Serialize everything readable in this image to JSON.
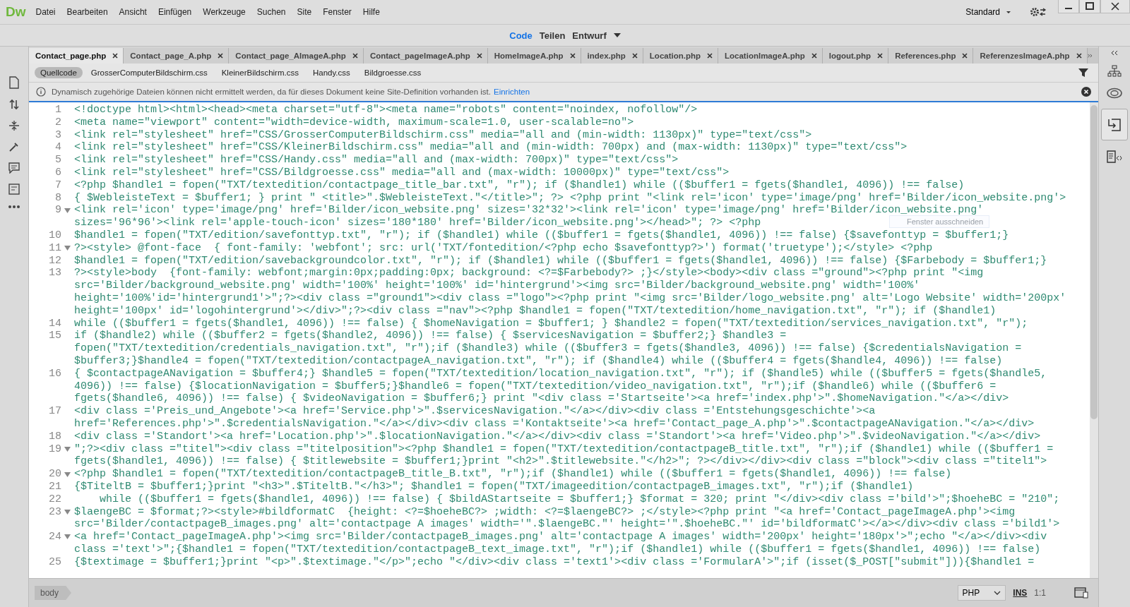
{
  "app_logo": "Dw",
  "menu": [
    "Datei",
    "Bearbeiten",
    "Ansicht",
    "Einfügen",
    "Werkzeuge",
    "Suchen",
    "Site",
    "Fenster",
    "Hilfe"
  ],
  "workspace": "Standard",
  "view_switcher": [
    {
      "label": "Code",
      "selected": true
    },
    {
      "label": "Teilen",
      "selected": false
    },
    {
      "label": "Entwurf",
      "selected": false
    }
  ],
  "tabs": [
    {
      "label": "Contact_page.php",
      "selected": true
    },
    {
      "label": "Contact_page_A.php",
      "selected": false
    },
    {
      "label": "Contact_page_AImageA.php",
      "selected": false
    },
    {
      "label": "Contact_pageImageA.php",
      "selected": false
    },
    {
      "label": "HomeImageA.php",
      "selected": false
    },
    {
      "label": "index.php",
      "selected": false
    },
    {
      "label": "Location.php",
      "selected": false
    },
    {
      "label": "LocationImageA.php",
      "selected": false
    },
    {
      "label": "logout.php",
      "selected": false
    },
    {
      "label": "References.php",
      "selected": false
    },
    {
      "label": "ReferenzesImageA.php",
      "selected": false
    }
  ],
  "related_files": [
    {
      "label": "Quellcode",
      "selected": true
    },
    {
      "label": "GrosserComputerBildschirm.css",
      "selected": false
    },
    {
      "label": "KleinerBildschirm.css",
      "selected": false
    },
    {
      "label": "Handy.css",
      "selected": false
    },
    {
      "label": "Bildgroesse.css",
      "selected": false
    }
  ],
  "info_bar": {
    "message": "Dynamisch zugehörige Dateien können nicht ermittelt werden, da für dieses Dokument keine Site-Definition vorhanden ist.",
    "link": "Einrichten"
  },
  "floating_hint": "Fenster ausschneiden",
  "code_lines": [
    {
      "number": "1",
      "foldable": false,
      "rows": [
        "<!doctype html><html><head><meta charset=\"utf-8\"><meta name=\"robots\" content=\"noindex, nofollow\"/>"
      ]
    },
    {
      "number": "2",
      "foldable": false,
      "rows": [
        "<meta name=\"viewport\" content=\"width=device-width, maximum-scale=1.0, user-scalable=no\">"
      ]
    },
    {
      "number": "3",
      "foldable": false,
      "rows": [
        "<link rel=\"stylesheet\" href=\"CSS/GrosserComputerBildschirm.css\" media=\"all and (min-width: 1130px)\" type=\"text/css\">"
      ]
    },
    {
      "number": "4",
      "foldable": false,
      "rows": [
        "<link rel=\"stylesheet\" href=\"CSS/KleinerBildschirm.css\" media=\"all and (min-width: 700px) and (max-width: 1130px)\" type=\"text/css\">"
      ]
    },
    {
      "number": "5",
      "foldable": false,
      "rows": [
        "<link rel=\"stylesheet\" href=\"CSS/Handy.css\" media=\"all and (max-width: 700px)\" type=\"text/css\">"
      ]
    },
    {
      "number": "6",
      "foldable": false,
      "rows": [
        "<link rel=\"stylesheet\" href=\"CSS/Bildgroesse.css\" media=\"all and (max-width: 10000px)\" type=\"text/css\">"
      ]
    },
    {
      "number": "7",
      "foldable": false,
      "rows": [
        "<?php $handle1 = fopen(\"TXT/textedition/contactpage_title_bar.txt\", \"r\"); if ($handle1) while (($buffer1 = fgets($handle1, 4096)) !== false)"
      ]
    },
    {
      "number": "8",
      "foldable": false,
      "rows": [
        "{ $WebleisteText = $buffer1; } print \" <title>\".$WebleisteText.\"</title>\"; ?> <?php print \"<link rel='icon' type='image/png' href='Bilder/icon_website.png'>"
      ]
    },
    {
      "number": "9",
      "foldable": true,
      "rows": [
        "<link rel='icon' type='image/png' href='Bilder/icon_website.png' sizes='32*32'><link rel='icon' type='image/png' href='Bilder/icon_website.png'",
        "sizes='96*96'><link rel='apple-touch-icon' sizes='180*180' href='Bilder/icon_website.png'></head>\"; ?> <?php"
      ]
    },
    {
      "number": "10",
      "foldable": false,
      "rows": [
        "$handle1 = fopen(\"TXT/edition/savefonttyp.txt\", \"r\"); if ($handle1) while (($buffer1 = fgets($handle1, 4096)) !== false) {$savefonttyp = $buffer1;}"
      ]
    },
    {
      "number": "11",
      "foldable": true,
      "rows": [
        "?><style> @font-face  { font-family: 'webfont'; src: url('TXT/fontedition/<?php echo $savefonttyp?>') format('truetype');</style> <?php"
      ]
    },
    {
      "number": "12",
      "foldable": false,
      "rows": [
        "$handle1 = fopen(\"TXT/edition/savebackgroundcolor.txt\", \"r\"); if ($handle1) while (($buffer1 = fgets($handle1, 4096)) !== false) {$Farbebody = $buffer1;}"
      ]
    },
    {
      "number": "13",
      "foldable": false,
      "rows": [
        "?><style>body  {font-family: webfont;margin:0px;padding:0px; background: <?=$Farbebody?> ;}</style><body><div class =\"ground\"><?php print \"<img",
        "src='Bilder/background_website.png' width='100%' height='100%' id='hintergrund'><img src='Bilder/background_website.png' width='100%'",
        "height='100%'id='hintergrund1'>\";?><div class =\"ground1\"><div class =\"logo\"><?php print \"<img src='Bilder/logo_website.png' alt='Logo Website' width='200px'",
        "height='100px' id='logohintergrund'></div>\";?><div class =\"nav\"><?php $handle1 = fopen(\"TXT/textedition/home_navigation.txt\", \"r\"); if ($handle1)"
      ]
    },
    {
      "number": "14",
      "foldable": false,
      "rows": [
        "while (($buffer1 = fgets($handle1, 4096)) !== false) { $homeNavigation = $buffer1; } $handle2 = fopen(\"TXT/textedition/services_navigation.txt\", \"r\");"
      ]
    },
    {
      "number": "15",
      "foldable": false,
      "rows": [
        "if ($handle2) while (($buffer2 = fgets($handle2, 4096)) !== false) { $servicesNavigation = $buffer2;} $handle3 =",
        "fopen(\"TXT/textedition/credentials_navigation.txt\", \"r\");if ($handle3) while (($buffer3 = fgets($handle3, 4096)) !== false) {$credentialsNavigation =",
        "$buffer3;}$handle4 = fopen(\"TXT/textedition/contactpageA_navigation.txt\", \"r\"); if ($handle4) while (($buffer4 = fgets($handle4, 4096)) !== false)"
      ]
    },
    {
      "number": "16",
      "foldable": false,
      "rows": [
        "{ $contactpageANavigation = $buffer4;} $handle5 = fopen(\"TXT/textedition/location_navigation.txt\", \"r\"); if ($handle5) while (($buffer5 = fgets($handle5,",
        "4096)) !== false) {$locationNavigation = $buffer5;}$handle6 = fopen(\"TXT/textedition/video_navigation.txt\", \"r\");if ($handle6) while (($buffer6 =",
        "fgets($handle6, 4096)) !== false) { $videoNavigation = $buffer6;} print \"<div class ='Startseite'><a href='index.php'>\".$homeNavigation.\"</a></div>"
      ]
    },
    {
      "number": "17",
      "foldable": false,
      "rows": [
        "<div class ='Preis_und_Angebote'><a href='Service.php'>\".$servicesNavigation.\"</a></div><div class ='Entstehungsgeschichte'><a",
        "href='References.php'>\".$credentialsNavigation.\"</a></div><div class ='Kontaktseite'><a href='Contact_page_A.php'>\".$contactpageANavigation.\"</a></div>"
      ]
    },
    {
      "number": "18",
      "foldable": false,
      "rows": [
        "<div class ='Standort'><a href='Location.php'>\".$locationNavigation.\"</a></div><div class ='Standort'><a href='Video.php'>\".$videoNavigation.\"</a></div>"
      ]
    },
    {
      "number": "19",
      "foldable": true,
      "rows": [
        "\";?><div class =\"titel\"><div class =\"titelposition\"><?php $handle1 = fopen(\"TXT/textedition/contactpageB_title.txt\", \"r\");if ($handle1) while (($buffer1 =",
        "fgets($handle1, 4096)) !== false) { $titlewebsite = $buffer1;}print \"<h2>\".$titlewebsite.\"</h2>\"; ?></div></div><div class =\"block\"><div class =\"titel1\">"
      ]
    },
    {
      "number": "20",
      "foldable": true,
      "rows": [
        "<?php $handle1 = fopen(\"TXT/textedition/contactpageB_title_B.txt\", \"r\");if ($handle1) while (($buffer1 = fgets($handle1, 4096)) !== false)"
      ]
    },
    {
      "number": "21",
      "foldable": false,
      "rows": [
        "{$TiteltB = $buffer1;}print \"<h3>\".$TiteltB.\"</h3>\"; $handle1 = fopen(\"TXT/imageedition/contactpageB_images.txt\", \"r\");if ($handle1)"
      ]
    },
    {
      "number": "22",
      "foldable": false,
      "rows": [
        "    while (($buffer1 = fgets($handle1, 4096)) !== false) { $bildAStartseite = $buffer1;} $format = 320; print \"</div><div class ='bild'>\";$hoeheBC = \"210\";"
      ]
    },
    {
      "number": "23",
      "foldable": true,
      "rows": [
        "$laengeBC = $format;?><style>#bildformatC  {height: <?=$hoeheBC?> ;width: <?=$laengeBC?> ;</style><?php print \"<a href='Contact_pageImageA.php'><img",
        "src='Bilder/contactpageB_images.png' alt='contactpage A images' width='\".$laengeBC.\"' height='\".$hoeheBC.\"' id='bildformatC'></a></div><div class ='bild1'>"
      ]
    },
    {
      "number": "24",
      "foldable": true,
      "rows": [
        "<a href='Contact_pageImageA.php'><img src='Bilder/contactpageB_images.png' alt='contactpage A images' width='200px' height='180px'>\";echo \"</a></div><div",
        "class ='text'>\";{$handle1 = fopen(\"TXT/textedition/contactpageB_text_image.txt\", \"r\");if ($handle1) while (($buffer1 = fgets($handle1, 4096)) !== false)"
      ]
    },
    {
      "number": "25",
      "foldable": false,
      "rows": [
        "{$textimage = $buffer1;}print \"<p>\".$textimage.\"</p>\";echo \"</div><div class ='text1'><div class ='FormularA'>\";if (isset($_POST[\"submit\"])){$handle1 ="
      ]
    }
  ],
  "status_bar": {
    "tag": "body",
    "language": "PHP",
    "mode": "INS",
    "position": "1:1"
  }
}
